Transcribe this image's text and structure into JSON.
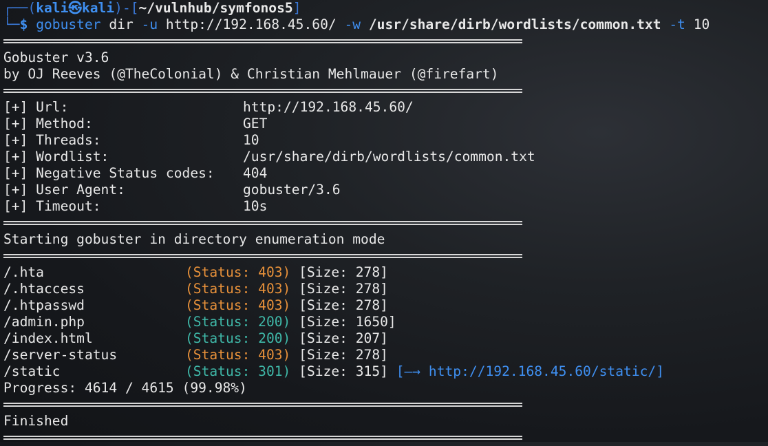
{
  "prompt": {
    "top_left": "┌──(",
    "user": "kali㉿kali",
    "mid": ")-[",
    "path": "~/vulnhub/symfonos5",
    "close": "]",
    "bottom_left": "└─",
    "dollar": "$",
    "cmd": "gobuster",
    "args1": " dir ",
    "flag_u": "-u",
    "url": " http://192.168.45.60/ ",
    "flag_w": "-w",
    "wordlist": " /usr/share/dirb/wordlists/common.txt ",
    "flag_t": "-t",
    "threads": " 10"
  },
  "banner": {
    "title": "Gobuster v3.6",
    "authors": "by OJ Reeves (@TheColonial) & Christian Mehlmauer (@firefart)"
  },
  "config": [
    {
      "label": "[+] Url:",
      "value": "http://192.168.45.60/"
    },
    {
      "label": "[+] Method:",
      "value": "GET"
    },
    {
      "label": "[+] Threads:",
      "value": "10"
    },
    {
      "label": "[+] Wordlist:",
      "value": "/usr/share/dirb/wordlists/common.txt"
    },
    {
      "label": "[+] Negative Status codes:",
      "value": "404"
    },
    {
      "label": "[+] User Agent:",
      "value": "gobuster/3.6"
    },
    {
      "label": "[+] Timeout:",
      "value": "10s"
    }
  ],
  "start_msg": "Starting gobuster in directory enumeration mode",
  "results": [
    {
      "path": "/.hta",
      "status": "(Status: 403)",
      "size": "[Size: 278]",
      "code": "403",
      "redirect": ""
    },
    {
      "path": "/.htaccess",
      "status": "(Status: 403)",
      "size": "[Size: 278]",
      "code": "403",
      "redirect": ""
    },
    {
      "path": "/.htpasswd",
      "status": "(Status: 403)",
      "size": "[Size: 278]",
      "code": "403",
      "redirect": ""
    },
    {
      "path": "/admin.php",
      "status": "(Status: 200)",
      "size": "[Size: 1650]",
      "code": "200",
      "redirect": ""
    },
    {
      "path": "/index.html",
      "status": "(Status: 200)",
      "size": "[Size: 207]",
      "code": "200",
      "redirect": ""
    },
    {
      "path": "/server-status",
      "status": "(Status: 403)",
      "size": "[Size: 278]",
      "code": "403",
      "redirect": ""
    },
    {
      "path": "/static",
      "status": "(Status: 301)",
      "size": "[Size: 315]",
      "code": "301",
      "redirect": "[—→ http://192.168.45.60/static/]"
    }
  ],
  "progress": "Progress: 4614 / 4615 (99.98%)",
  "finished": "Finished"
}
